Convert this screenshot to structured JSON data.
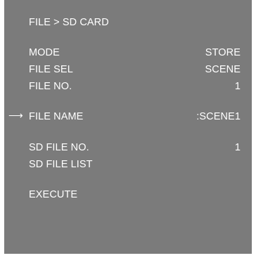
{
  "menu": {
    "title": "FILE > SD CARD",
    "items": [
      {
        "label": "MODE",
        "value": "STORE"
      },
      {
        "label": "FILE SEL",
        "value": "SCENE"
      },
      {
        "label": "FILE NO.",
        "value": "1"
      },
      {
        "label": "FILE NAME",
        "value": ":SCENE1",
        "selected": true
      },
      {
        "label": "SD FILE NO.",
        "value": "1"
      },
      {
        "label": "SD FILE LIST",
        "value": ""
      },
      {
        "label": "EXECUTE",
        "value": ""
      }
    ],
    "cursor_icon": "right-arrow-icon",
    "colors": {
      "background": "#7b7b7b",
      "text": "#ffffff"
    }
  }
}
